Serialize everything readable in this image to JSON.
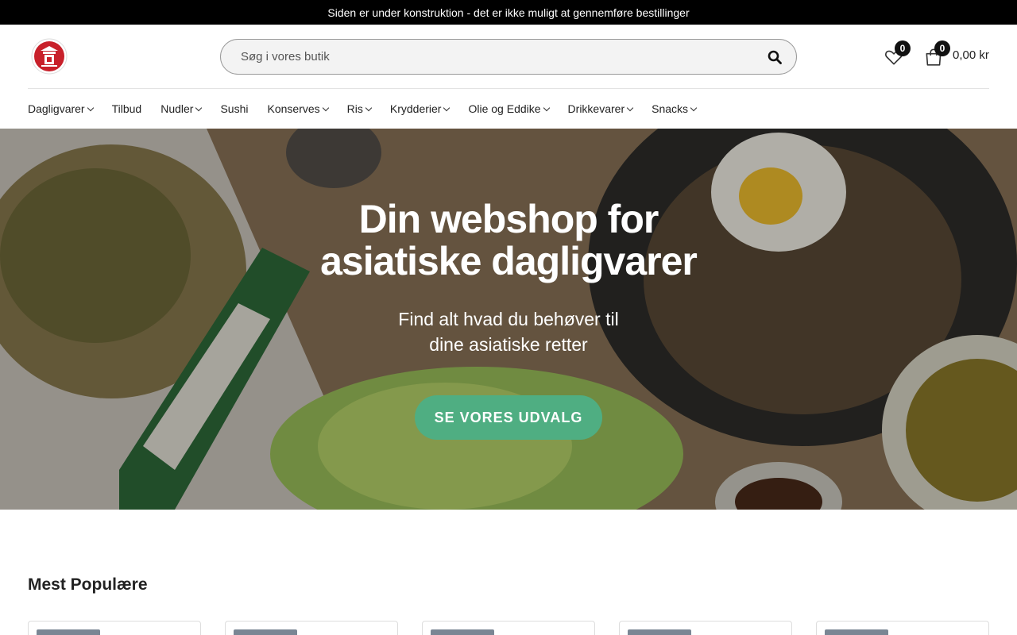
{
  "topbar": {
    "notice": "Siden er under konstruktion - det er ikke muligt at gennemføre bestillinger"
  },
  "header": {
    "search_placeholder": "Søg i vores butik",
    "wishlist_count": "0",
    "cart_count": "0",
    "cart_total": "0,00 kr"
  },
  "nav": {
    "items": [
      {
        "label": "Dagligvarer",
        "has_dropdown": true
      },
      {
        "label": "Tilbud",
        "has_dropdown": false
      },
      {
        "label": "Nudler",
        "has_dropdown": true
      },
      {
        "label": "Sushi",
        "has_dropdown": false
      },
      {
        "label": "Konserves",
        "has_dropdown": true
      },
      {
        "label": "Ris",
        "has_dropdown": true
      },
      {
        "label": "Krydderier",
        "has_dropdown": true
      },
      {
        "label": "Olie og Eddike",
        "has_dropdown": true
      },
      {
        "label": "Drikkevarer",
        "has_dropdown": true
      },
      {
        "label": "Snacks",
        "has_dropdown": true
      }
    ]
  },
  "hero": {
    "title_line1": "Din webshop for",
    "title_line2": "asiatiske dagligvarer",
    "subtitle_line1": "Find alt hvad du behøver til",
    "subtitle_line2": "dine asiatiske retter",
    "cta_label": "SE VORES UDVALG"
  },
  "popular": {
    "title": "Mest Populære"
  },
  "colors": {
    "accent": "#4fae82",
    "topbar": "#000000",
    "logo": "#c8202a"
  },
  "icons": [
    "logo",
    "search-icon",
    "heart-icon",
    "bag-icon",
    "chevron-down-icon"
  ]
}
